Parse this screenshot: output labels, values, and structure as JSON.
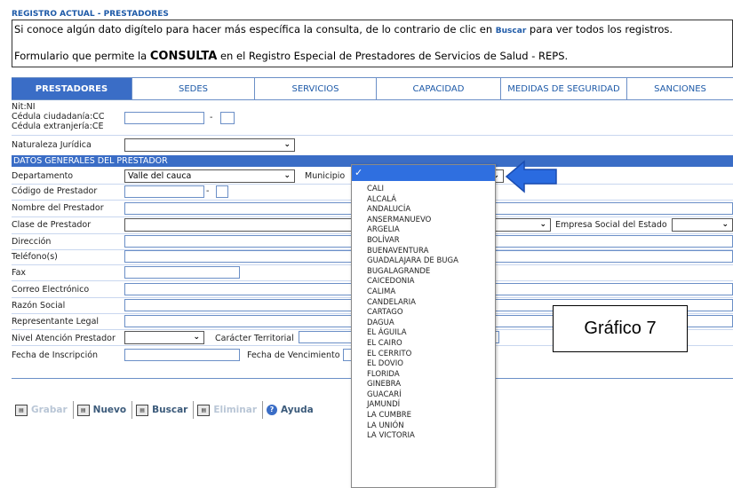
{
  "header": {
    "title": "REGISTRO ACTUAL - PRESTADORES",
    "info_part1": "Si conoce algún dato digítelo para hacer más específica la consulta, de lo contrario de clic en ",
    "info_link": "Buscar",
    "info_part2": " para ver todos los registros.",
    "form_part1": "Formulario que permite la ",
    "form_bold": "CONSULTA",
    "form_part2": " en el Registro Especial de Prestadores de Servicios de Salud - REPS."
  },
  "tabs": [
    "PRESTADORES",
    "SEDES",
    "SERVICIOS",
    "CAPACIDAD",
    "MEDIDAS DE SEGURIDAD",
    "SANCIONES"
  ],
  "form": {
    "nit_label_1": "Nit:NI",
    "nit_label_2": "Cédula ciudadanía:CC",
    "nit_label_3": "Cédula extranjería:CE",
    "dash": "-",
    "naturaleza_label": "Naturaleza Jurídica",
    "section_title": "DATOS GENERALES DEL PRESTADOR",
    "departamento_label": "Departamento",
    "departamento_value": "Valle del cauca",
    "municipio_label": "Municipio",
    "codigo_label": "Código de Prestador",
    "nombre_label": "Nombre del Prestador",
    "clase_label": "Clase de Prestador",
    "empresa_label": "Empresa Social del Estado",
    "direccion_label": "Dirección",
    "telefono_label": "Teléfono(s)",
    "fax_label": "Fax",
    "correo_label": "Correo Electrónico",
    "razon_label": "Razón Social",
    "representante_label": "Representante Legal",
    "nivel_label": "Nivel Atención Prestador",
    "caracter_label": "Carácter Territorial",
    "fecha_inscripcion_label": "Fecha de Inscripción",
    "fecha_vencimiento_label": "Fecha de Vencimiento"
  },
  "dropdown": {
    "selected_mark": "✓",
    "options": [
      "CALI",
      "ALCALÁ",
      "ANDALUCÍA",
      "ANSERMANUEVO",
      "ARGELIA",
      "BOLÍVAR",
      "BUENAVENTURA",
      "GUADALAJARA DE BUGA",
      "BUGALAGRANDE",
      "CAICEDONIA",
      "CALIMA",
      "CANDELARIA",
      "CARTAGO",
      "DAGUA",
      "EL ÁGUILA",
      "EL CAIRO",
      "EL CERRITO",
      "EL DOVIO",
      "FLORIDA",
      "GINEBRA",
      "GUACARÍ",
      "JAMUNDÍ",
      "LA CUMBRE",
      "LA UNIÓN",
      "LA VICTORIA"
    ]
  },
  "annotation": {
    "label": "Gráfico 7"
  },
  "toolbar": {
    "grabar": "Grabar",
    "nuevo": "Nuevo",
    "buscar": "Buscar",
    "eliminar": "Eliminar",
    "ayuda": "Ayuda"
  },
  "colors": {
    "accent": "#3a6dc6",
    "link": "#1e5aa8",
    "arrow": "#2a6be0"
  }
}
